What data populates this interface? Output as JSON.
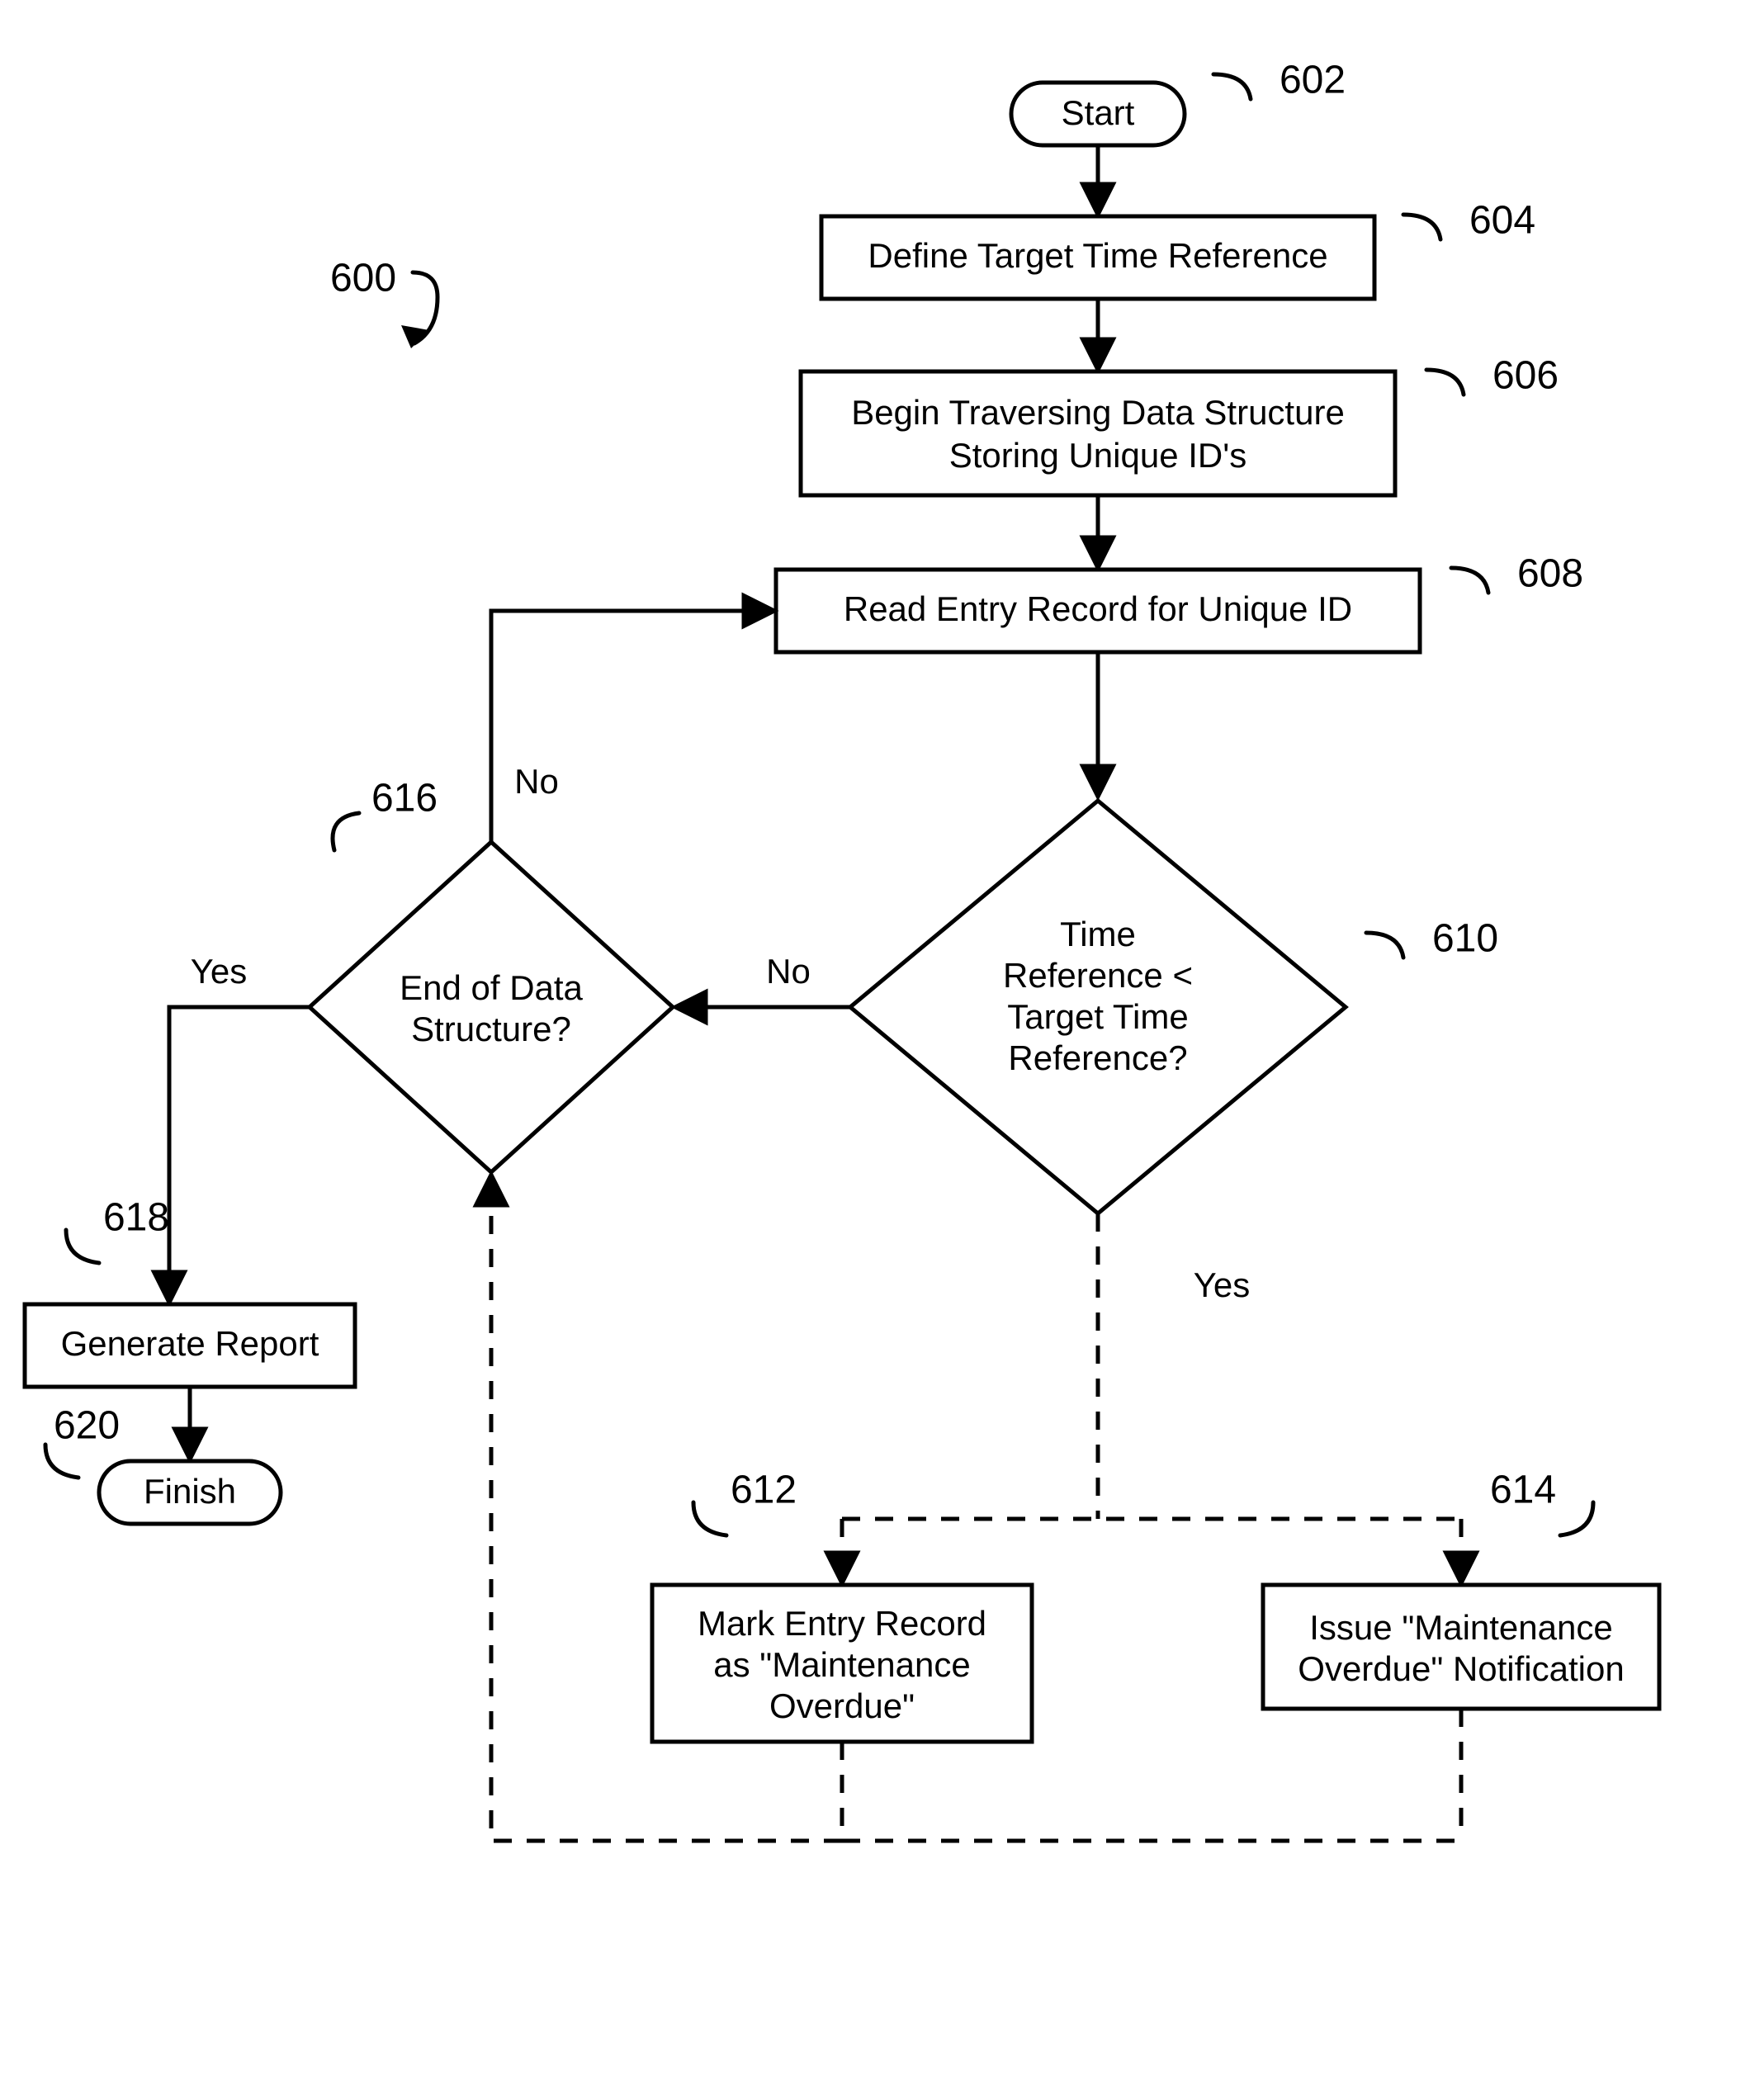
{
  "refs": {
    "r600": "600",
    "r602": "602",
    "r604": "604",
    "r606": "606",
    "r608": "608",
    "r610": "610",
    "r612": "612",
    "r614": "614",
    "r616": "616",
    "r618": "618",
    "r620": "620"
  },
  "nodes": {
    "start": "Start",
    "n604": "Define Target Time Reference",
    "n606": "Begin Traversing Data Structure Storing Unique ID's",
    "n608": "Read Entry Record for Unique ID",
    "d610_l1": "Time",
    "d610_l2": "Reference <",
    "d610_l3": "Target Time",
    "d610_l4": "Reference?",
    "d616_l1": "End of Data",
    "d616_l2": "Structure?",
    "n612_l1": "Mark Entry Record",
    "n612_l2": "as \"Maintenance",
    "n612_l3": "Overdue\"",
    "n614_l1": "Issue \"Maintenance",
    "n614_l2": "Overdue\" Notification",
    "n618": "Generate Report",
    "finish": "Finish"
  },
  "edges": {
    "yes": "Yes",
    "no": "No"
  },
  "chart_data": {
    "type": "flowchart",
    "nodes": [
      {
        "id": "602",
        "type": "terminator",
        "label": "Start"
      },
      {
        "id": "604",
        "type": "process",
        "label": "Define Target Time Reference"
      },
      {
        "id": "606",
        "type": "process",
        "label": "Begin Traversing Data Structure Storing Unique ID's"
      },
      {
        "id": "608",
        "type": "process",
        "label": "Read Entry Record for Unique ID"
      },
      {
        "id": "610",
        "type": "decision",
        "label": "Time Reference < Target Time Reference?"
      },
      {
        "id": "616",
        "type": "decision",
        "label": "End of Data Structure?"
      },
      {
        "id": "612",
        "type": "process",
        "label": "Mark Entry Record as \"Maintenance Overdue\"",
        "optional": true
      },
      {
        "id": "614",
        "type": "process",
        "label": "Issue \"Maintenance Overdue\" Notification",
        "optional": true
      },
      {
        "id": "618",
        "type": "process",
        "label": "Generate Report"
      },
      {
        "id": "620",
        "type": "terminator",
        "label": "Finish"
      }
    ],
    "edges": [
      {
        "from": "602",
        "to": "604"
      },
      {
        "from": "604",
        "to": "606"
      },
      {
        "from": "606",
        "to": "608"
      },
      {
        "from": "608",
        "to": "610"
      },
      {
        "from": "610",
        "to": "616",
        "label": "No"
      },
      {
        "from": "610",
        "to": "612",
        "label": "Yes",
        "style": "dashed"
      },
      {
        "from": "610",
        "to": "614",
        "label": "Yes",
        "style": "dashed"
      },
      {
        "from": "612",
        "to": "616",
        "style": "dashed"
      },
      {
        "from": "614",
        "to": "616",
        "style": "dashed"
      },
      {
        "from": "616",
        "to": "608",
        "label": "No"
      },
      {
        "from": "616",
        "to": "618",
        "label": "Yes"
      },
      {
        "from": "618",
        "to": "620"
      }
    ]
  }
}
